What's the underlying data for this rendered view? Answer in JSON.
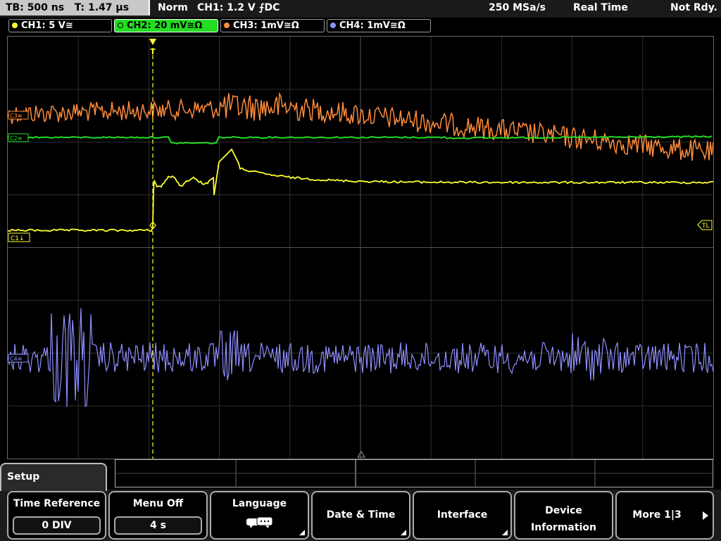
{
  "status": {
    "timebase": "TB: 500 ns",
    "trigger_time": "T: 1.47 µs",
    "trigger_mode": "Norm",
    "trigger_info": "CH1: 1.2 V ⨍DC",
    "sample_rate": "250 MSa/s",
    "acq_mode": "Real Time",
    "state": "Not Rdy."
  },
  "channels": [
    {
      "label": "CH1: 5 V≅",
      "color": "#ffff30"
    },
    {
      "label": "CH2: 20 mV≅Ω",
      "color": "#22dd22"
    },
    {
      "label": "CH3: 1mV≅Ω",
      "color": "#ff8c3c"
    },
    {
      "label": "CH4: 1mV≅Ω",
      "color": "#8f8fff"
    }
  ],
  "markers": {
    "ch1": "C1↓",
    "ch2": "C2≅",
    "ch3": "C3≅",
    "ch4": "C4≅",
    "trigger_level": "TL",
    "trigger_position": "T"
  },
  "menu": {
    "setup_tab": "Setup",
    "time_reference": {
      "label": "Time Reference",
      "value": "0 DIV"
    },
    "menu_off": {
      "label": "Menu Off",
      "value": "4 s"
    },
    "language": {
      "label": "Language"
    },
    "date_time": {
      "label": "Date & Time"
    },
    "interface": {
      "label": "Interface"
    },
    "device_info": {
      "label1": "Device",
      "label2": "Information"
    },
    "more": {
      "label": "More 1|3"
    }
  }
}
